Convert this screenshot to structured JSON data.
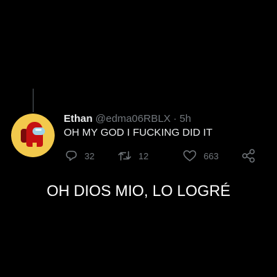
{
  "tweet": {
    "display_name": "Ethan",
    "handle": "@edma06RBLX",
    "separator": "·",
    "time": "5h",
    "text": "OH MY GOD I FUCKING DID IT",
    "avatar_icon": "among-us-crewmate-icon",
    "actions": {
      "reply_count": "32",
      "retweet_count": "12",
      "like_count": "663"
    }
  },
  "caption": "OH DIOS MIO, LO LOGRÉ",
  "colors": {
    "background": "#000000",
    "text_primary": "#e7e9ea",
    "text_secondary": "#71767b",
    "avatar_bg": "#f2c94c",
    "crewmate_red": "#c51111"
  }
}
